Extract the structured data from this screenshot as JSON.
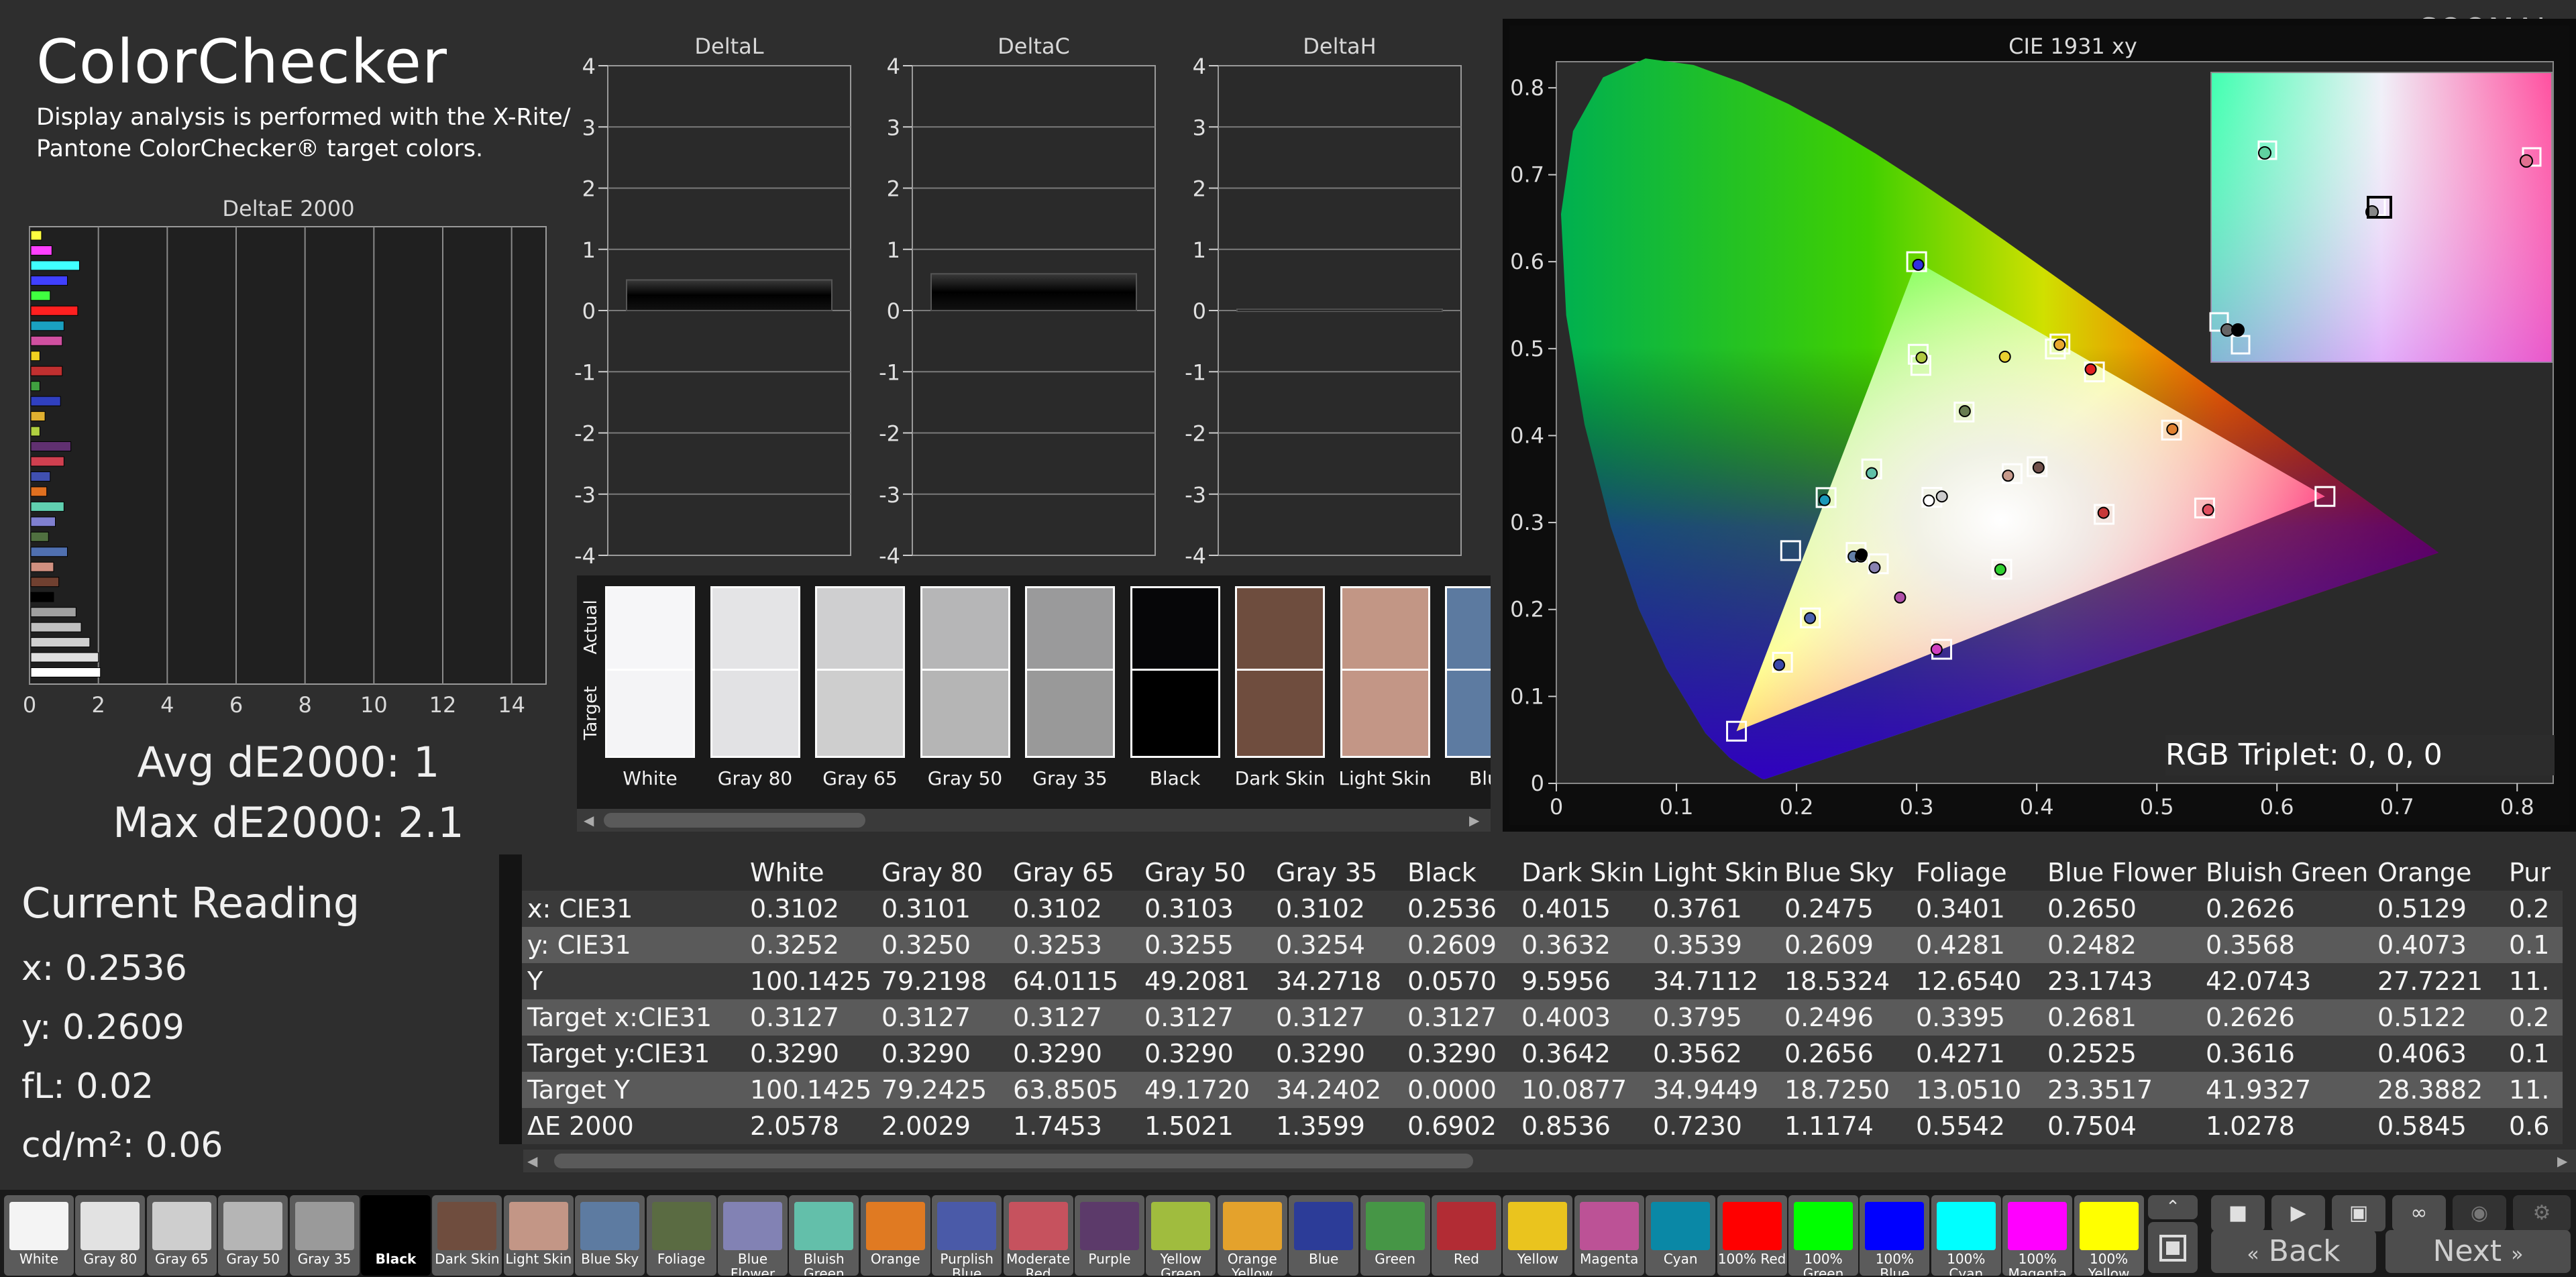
{
  "brand": "SOOMAL",
  "title": "ColorChecker",
  "subtitle": "Display analysis is performed with the X-Rite/ Pantone ColorChecker® target colors.",
  "deltaE_chart": {
    "title": "DeltaE 2000",
    "ticks": [
      "0",
      "2",
      "4",
      "6",
      "8",
      "10",
      "12",
      "14"
    ],
    "xlim": [
      0,
      15
    ],
    "bars": [
      {
        "value": 0.35,
        "color": "#ffff40"
      },
      {
        "value": 0.65,
        "color": "#ff40ff"
      },
      {
        "value": 1.45,
        "color": "#40ffff"
      },
      {
        "value": 1.1,
        "color": "#4040ff"
      },
      {
        "value": 0.6,
        "color": "#40ff40"
      },
      {
        "value": 1.4,
        "color": "#ff2020"
      },
      {
        "value": 1.0,
        "color": "#1aa0c0"
      },
      {
        "value": 0.95,
        "color": "#d050a0"
      },
      {
        "value": 0.3,
        "color": "#f0d020"
      },
      {
        "value": 0.95,
        "color": "#c03030"
      },
      {
        "value": 0.3,
        "color": "#40a040"
      },
      {
        "value": 0.9,
        "color": "#3040c0"
      },
      {
        "value": 0.45,
        "color": "#e0b030"
      },
      {
        "value": 0.3,
        "color": "#b0d040"
      },
      {
        "value": 1.2,
        "color": "#603070"
      },
      {
        "value": 1.0,
        "color": "#d04050"
      },
      {
        "value": 0.6,
        "color": "#4050b0"
      },
      {
        "value": 0.5,
        "color": "#e07020"
      },
      {
        "value": 1.0,
        "color": "#60d0b0"
      },
      {
        "value": 0.75,
        "color": "#8080d0"
      },
      {
        "value": 0.55,
        "color": "#507040"
      },
      {
        "value": 1.1,
        "color": "#5070b0"
      },
      {
        "value": 0.7,
        "color": "#d09080"
      },
      {
        "value": 0.85,
        "color": "#704030"
      },
      {
        "value": 0.7,
        "color": "#000000"
      },
      {
        "value": 1.35,
        "color": "#a0a0a0"
      },
      {
        "value": 1.5,
        "color": "#c0c0c0"
      },
      {
        "value": 1.75,
        "color": "#d0d0d0"
      },
      {
        "value": 2.0,
        "color": "#e0e0e0"
      },
      {
        "value": 2.06,
        "color": "#ffffff"
      }
    ]
  },
  "avg_label": "Avg dE2000: 1",
  "max_label": "Max dE2000: 2.1",
  "delta_charts": [
    {
      "title": "DeltaL",
      "value": 0.5,
      "ticks": [
        "4",
        "3",
        "2",
        "1",
        "0",
        "-1",
        "-2",
        "-3",
        "-4"
      ]
    },
    {
      "title": "DeltaC",
      "value": 0.6,
      "ticks": [
        "4",
        "3",
        "2",
        "1",
        "0",
        "-1",
        "-2",
        "-3",
        "-4"
      ]
    },
    {
      "title": "DeltaH",
      "value": 0.02,
      "ticks": [
        "4",
        "3",
        "2",
        "1",
        "0",
        "-1",
        "-2",
        "-3",
        "-4"
      ]
    }
  ],
  "swatch_strip": {
    "actual_label": "Actual",
    "target_label": "Target",
    "swatches": [
      {
        "name": "White",
        "actual": "#f6f6f8",
        "target": "#f4f4f6"
      },
      {
        "name": "Gray 80",
        "actual": "#e4e4e6",
        "target": "#e2e2e4"
      },
      {
        "name": "Gray 65",
        "actual": "#cfcfd0",
        "target": "#cecece"
      },
      {
        "name": "Gray 50",
        "actual": "#b6b6b7",
        "target": "#b5b5b5"
      },
      {
        "name": "Gray 35",
        "actual": "#9a9a9b",
        "target": "#999999"
      },
      {
        "name": "Black",
        "actual": "#060608",
        "target": "#000000"
      },
      {
        "name": "Dark Skin",
        "actual": "#6e4d3e",
        "target": "#6f4d3e"
      },
      {
        "name": "Light Skin",
        "actual": "#c29685",
        "target": "#c39686"
      },
      {
        "name": "Blue",
        "actual": "#5c7aa0",
        "target": "#5d7ba1"
      }
    ]
  },
  "cie": {
    "title": "CIE 1931 xy",
    "x_ticks": [
      "0",
      "0.1",
      "0.2",
      "0.3",
      "0.4",
      "0.5",
      "0.6",
      "0.7",
      "0.8"
    ],
    "y_ticks": [
      "0",
      "0.1",
      "0.2",
      "0.3",
      "0.4",
      "0.5",
      "0.6",
      "0.7",
      "0.8"
    ],
    "xlim": [
      0,
      0.83
    ],
    "ylim": [
      0,
      0.83
    ],
    "gamut": [
      [
        0.64,
        0.33
      ],
      [
        0.3,
        0.6
      ],
      [
        0.15,
        0.06
      ]
    ],
    "rgb_triplet": "RGB Triplet: 0, 0, 0",
    "targets": [
      [
        0.3127,
        0.329
      ],
      [
        0.4003,
        0.3642
      ],
      [
        0.3795,
        0.3562
      ],
      [
        0.2496,
        0.2656
      ],
      [
        0.3395,
        0.4271
      ],
      [
        0.2681,
        0.2525
      ],
      [
        0.2626,
        0.3616
      ],
      [
        0.5122,
        0.4063
      ],
      [
        0.2115,
        0.1903
      ],
      [
        0.4561,
        0.3094
      ],
      [
        0.3013,
        0.4935
      ],
      [
        0.4155,
        0.4996
      ],
      [
        0.1883,
        0.1393
      ],
      [
        0.3035,
        0.4807
      ],
      [
        0.5398,
        0.3167
      ],
      [
        0.448,
        0.4732
      ],
      [
        0.3709,
        0.2462
      ],
      [
        0.1951,
        0.2677
      ],
      [
        0.64,
        0.33
      ],
      [
        0.3,
        0.6
      ],
      [
        0.15,
        0.06
      ],
      [
        0.2246,
        0.3287
      ],
      [
        0.3209,
        0.1542
      ],
      [
        0.4193,
        0.5053
      ]
    ],
    "actuals": [
      [
        0.3102,
        0.3252
      ],
      [
        0.4015,
        0.3632
      ],
      [
        0.3761,
        0.3539
      ],
      [
        0.2475,
        0.2609
      ],
      [
        0.3401,
        0.4281
      ],
      [
        0.265,
        0.2482
      ],
      [
        0.2626,
        0.3568
      ],
      [
        0.5129,
        0.4073
      ],
      [
        0.2112,
        0.19
      ],
      [
        0.5427,
        0.3145
      ],
      [
        0.3041,
        0.4897
      ],
      [
        0.419,
        0.5045
      ],
      [
        0.1855,
        0.1362
      ],
      [
        0.2536,
        0.2609
      ],
      [
        0.4556,
        0.3112
      ],
      [
        0.3735,
        0.4907
      ],
      [
        0.2862,
        0.2138
      ],
      [
        0.2234,
        0.3258
      ],
      [
        0.4449,
        0.4762
      ],
      [
        0.3697,
        0.2459
      ],
      [
        0.3013,
        0.5964
      ],
      [
        0.3166,
        0.1541
      ],
      [
        0.2542,
        0.2632
      ],
      [
        0.321,
        0.33
      ]
    ],
    "actual_colors": [
      "#ffffff",
      "#70504a",
      "#c79a8b",
      "#6480a8",
      "#687c50",
      "#8882b0",
      "#60c0a8",
      "#e08030",
      "#4a60b0",
      "#e05060",
      "#b0c840",
      "#e8a830",
      "#3a48a8",
      "#404040",
      "#c83838",
      "#e8d030",
      "#b050a8",
      "#1a98b8",
      "#e02020",
      "#30d030",
      "#3030e0",
      "#d040c0",
      "#000000",
      "#cccccc"
    ]
  },
  "current_reading": {
    "title": "Current Reading",
    "x": "x: 0.2536",
    "y": "y: 0.2609",
    "fl": "fL: 0.02",
    "cdm2": "cd/m²: 0.06"
  },
  "table": {
    "columns": [
      "White",
      "Gray 80",
      "Gray 65",
      "Gray 50",
      "Gray 35",
      "Black",
      "Dark Skin",
      "Light Skin",
      "Blue Sky",
      "Foliage",
      "Blue Flower",
      "Bluish Green",
      "Orange",
      "Pur"
    ],
    "rows": [
      {
        "label": "x: CIE31",
        "values": [
          "0.3102",
          "0.3101",
          "0.3102",
          "0.3103",
          "0.3102",
          "0.2536",
          "0.4015",
          "0.3761",
          "0.2475",
          "0.3401",
          "0.2650",
          "0.2626",
          "0.5129",
          "0.2"
        ]
      },
      {
        "label": "y: CIE31",
        "values": [
          "0.3252",
          "0.3250",
          "0.3253",
          "0.3255",
          "0.3254",
          "0.2609",
          "0.3632",
          "0.3539",
          "0.2609",
          "0.4281",
          "0.2482",
          "0.3568",
          "0.4073",
          "0.1"
        ]
      },
      {
        "label": "Y",
        "values": [
          "100.1425",
          "79.2198",
          "64.0115",
          "49.2081",
          "34.2718",
          "0.0570",
          "9.5956",
          "34.7112",
          "18.5324",
          "12.6540",
          "23.1743",
          "42.0743",
          "27.7221",
          "11."
        ]
      },
      {
        "label": "Target x:CIE31",
        "values": [
          "0.3127",
          "0.3127",
          "0.3127",
          "0.3127",
          "0.3127",
          "0.3127",
          "0.4003",
          "0.3795",
          "0.2496",
          "0.3395",
          "0.2681",
          "0.2626",
          "0.5122",
          "0.2"
        ]
      },
      {
        "label": "Target y:CIE31",
        "values": [
          "0.3290",
          "0.3290",
          "0.3290",
          "0.3290",
          "0.3290",
          "0.3290",
          "0.3642",
          "0.3562",
          "0.2656",
          "0.4271",
          "0.2525",
          "0.3616",
          "0.4063",
          "0.1"
        ]
      },
      {
        "label": "Target Y",
        "values": [
          "100.1425",
          "79.2425",
          "63.8505",
          "49.1720",
          "34.2402",
          "0.0000",
          "10.0877",
          "34.9449",
          "18.7250",
          "13.0510",
          "23.3517",
          "41.9327",
          "28.3882",
          "11."
        ]
      },
      {
        "label": "ΔE 2000",
        "values": [
          "2.0578",
          "2.0029",
          "1.7453",
          "1.5021",
          "1.3599",
          "0.6902",
          "0.8536",
          "0.7230",
          "1.1174",
          "0.5542",
          "0.7504",
          "1.0278",
          "0.5845",
          "0.6"
        ]
      }
    ]
  },
  "bottom_swatches": [
    {
      "name": "White",
      "color": "#f4f4f4"
    },
    {
      "name": "Gray 80",
      "color": "#e2e2e2"
    },
    {
      "name": "Gray 65",
      "color": "#cecece"
    },
    {
      "name": "Gray 50",
      "color": "#b5b5b5"
    },
    {
      "name": "Gray 35",
      "color": "#9a9a9a"
    },
    {
      "name": "Black",
      "color": "#000000"
    },
    {
      "name": "Dark Skin",
      "color": "#6f4d3e"
    },
    {
      "name": "Light Skin",
      "color": "#c39686"
    },
    {
      "name": "Blue Sky",
      "color": "#5d7ba1"
    },
    {
      "name": "Foliage",
      "color": "#5a6b42"
    },
    {
      "name": "Blue Flower",
      "color": "#8282b4"
    },
    {
      "name": "Bluish Green",
      "color": "#63bfaa"
    },
    {
      "name": "Orange",
      "color": "#e07a22"
    },
    {
      "name": "Purplish Blue",
      "color": "#4a5aa8"
    },
    {
      "name": "Moderate Red",
      "color": "#c6525e"
    },
    {
      "name": "Purple",
      "color": "#5c3a6a"
    },
    {
      "name": "Yellow Green",
      "color": "#a0bc3e"
    },
    {
      "name": "Orange Yellow",
      "color": "#e4a22c"
    },
    {
      "name": "Blue",
      "color": "#2c3c98"
    },
    {
      "name": "Green",
      "color": "#469646"
    },
    {
      "name": "Red",
      "color": "#b22c34"
    },
    {
      "name": "Yellow",
      "color": "#eac41e"
    },
    {
      "name": "Magenta",
      "color": "#bc5296"
    },
    {
      "name": "Cyan",
      "color": "#0a88a6"
    },
    {
      "name": "100% Red",
      "color": "#ff0000"
    },
    {
      "name": "100% Green",
      "color": "#00ff00"
    },
    {
      "name": "100% Blue",
      "color": "#0000ff"
    },
    {
      "name": "100% Cyan",
      "color": "#00ffff"
    },
    {
      "name": "100% Magenta",
      "color": "#ff00ff"
    },
    {
      "name": "100% Yellow",
      "color": "#ffff00"
    }
  ],
  "controls": {
    "back_label": "Back",
    "next_label": "Next",
    "stop_icon": "stop-icon",
    "play_icon": "play-icon",
    "save_icon": "save-icon",
    "loop_icon": "loop-icon",
    "camera_icon": "camera-icon",
    "gear_icon": "gear-icon"
  }
}
